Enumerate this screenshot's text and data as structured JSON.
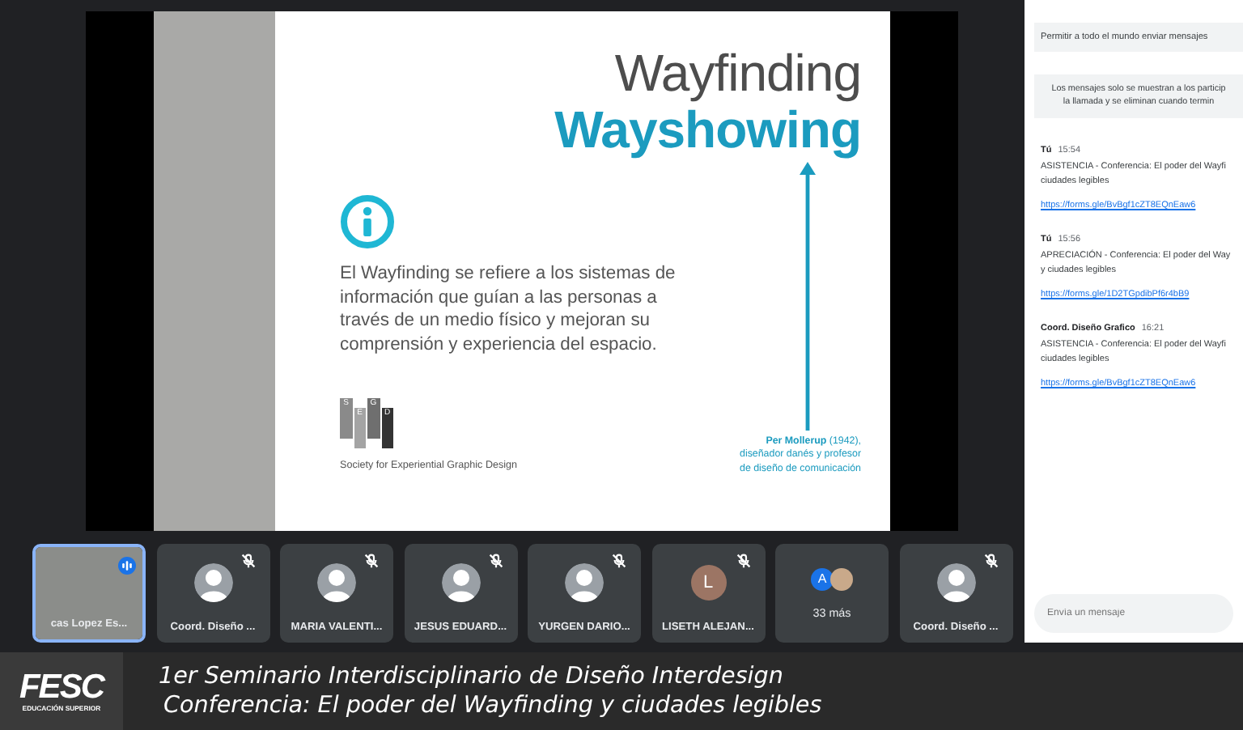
{
  "slide": {
    "title": "Wayfinding",
    "subtitle": "Wayshowing",
    "paragraph": "El Wayfinding se refiere a los sistemas de información que guían a las personas a través de un medio físico y mejoran su comprensión y experiencia del espacio.",
    "logo_letters": [
      "S",
      "E",
      "G",
      "D"
    ],
    "logo_caption": "Society for Experiential Graphic Design",
    "quote_lines": [
      "**Per Mollerup** (1942),",
      "diseñador danés y profesor",
      "de diseño de comunicación"
    ]
  },
  "participants": [
    {
      "kind": "video",
      "name": "cas Lopez Es...",
      "speaking": true,
      "muted": false
    },
    {
      "kind": "photo",
      "name": "Coord. Diseño ...",
      "speaking": false,
      "muted": true
    },
    {
      "kind": "photo",
      "name": "MARIA VALENTI...",
      "speaking": false,
      "muted": true
    },
    {
      "kind": "photo",
      "name": "JESUS EDUARD...",
      "speaking": false,
      "muted": true
    },
    {
      "kind": "photo",
      "name": "YURGEN DARIO...",
      "speaking": false,
      "muted": true
    },
    {
      "kind": "letter",
      "initial": "L",
      "name": "LISETH ALEJAN...",
      "speaking": false,
      "muted": true
    },
    {
      "kind": "overflow",
      "initial": "A",
      "name": "33 más",
      "speaking": false,
      "muted": false
    },
    {
      "kind": "photo",
      "name": "Coord. Diseño ...",
      "speaking": false,
      "muted": true
    }
  ],
  "chat": {
    "permission": "Permitir a todo el mundo enviar mensajes",
    "notice": [
      "Los mensajes solo se muestran a los particip",
      "la llamada y se eliminan cuando termin"
    ],
    "messages": [
      {
        "sender": "Tú",
        "time": "15:54",
        "lines": [
          "ASISTENCIA - Conferencia: El poder del Wayfi",
          "ciudades legibles"
        ],
        "link": "https://forms.gle/BvBgf1cZT8EQnEaw6"
      },
      {
        "sender": "Tú",
        "time": "15:56",
        "lines": [
          "APRECIACIÓN - Conferencia: El poder del Way",
          "y ciudades legibles"
        ],
        "link": "https://forms.gle/1D2TGpdibPf6r4bB9"
      },
      {
        "sender": "Coord. Diseño Grafico",
        "time": "16:21",
        "lines": [
          "ASISTENCIA - Conferencia: El poder del Wayfi",
          "ciudades legibles"
        ],
        "link": "https://forms.gle/BvBgf1cZT8EQnEaw6"
      }
    ],
    "input": {
      "placeholder": "Envía un mensaje"
    }
  },
  "banner": {
    "logo": "FESC",
    "logo_tagline": "EDUCACIÓN SUPERIOR",
    "lines": [
      "1er Seminario Interdisciplinario de Diseño Interdesign",
      "Conferencia: El poder del Wayfinding y ciudades legibles"
    ]
  }
}
